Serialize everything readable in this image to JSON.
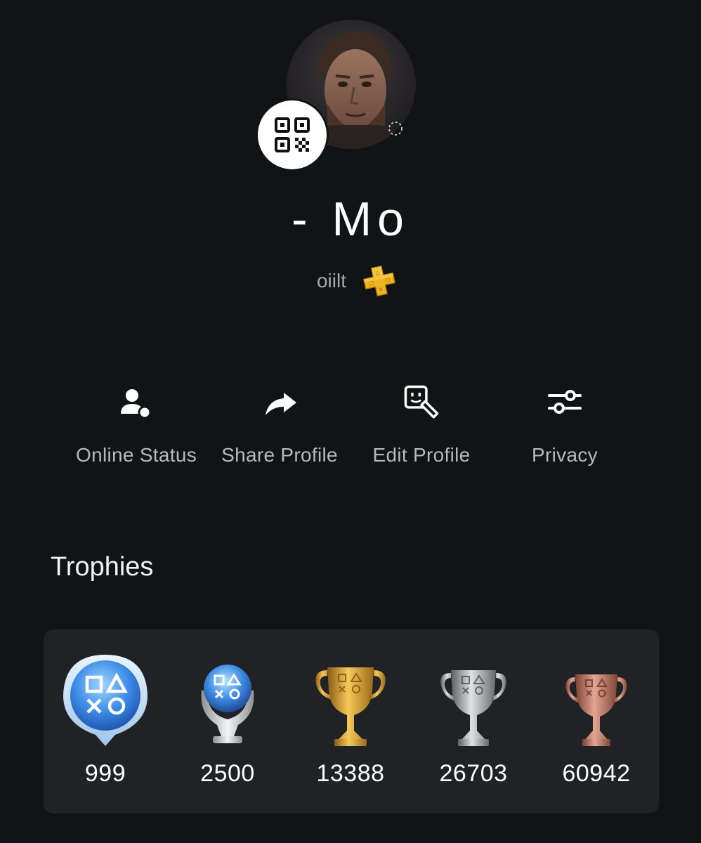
{
  "profile": {
    "display_name": "- Mo",
    "online_id": "oiilt",
    "plus_badge": "playstation-plus-icon",
    "avatar": "avatar-portrait",
    "qr_icon": "qr-code-icon"
  },
  "actions": [
    {
      "label": "Online Status",
      "icon": "user-status-icon"
    },
    {
      "label": "Share Profile",
      "icon": "share-arrow-icon"
    },
    {
      "label": "Edit Profile",
      "icon": "edit-avatar-icon"
    },
    {
      "label": "Privacy",
      "icon": "sliders-icon"
    }
  ],
  "trophies": {
    "title": "Trophies",
    "items": [
      {
        "type": "level",
        "count": "999",
        "icon": "trophy-level-icon"
      },
      {
        "type": "platinum",
        "count": "2500",
        "icon": "platinum-trophy-icon"
      },
      {
        "type": "gold",
        "count": "13388",
        "icon": "gold-trophy-icon"
      },
      {
        "type": "silver",
        "count": "26703",
        "icon": "silver-trophy-icon"
      },
      {
        "type": "bronze",
        "count": "60942",
        "icon": "bronze-trophy-icon"
      }
    ]
  },
  "colors": {
    "background": "#121314",
    "card": "#202225",
    "text_secondary": "#b9b9b9",
    "plus_gold": "#f0b323",
    "gold": "#d9a530",
    "silver": "#a9abae",
    "bronze": "#c07a68",
    "platinum_blue": "#3d8be8"
  }
}
